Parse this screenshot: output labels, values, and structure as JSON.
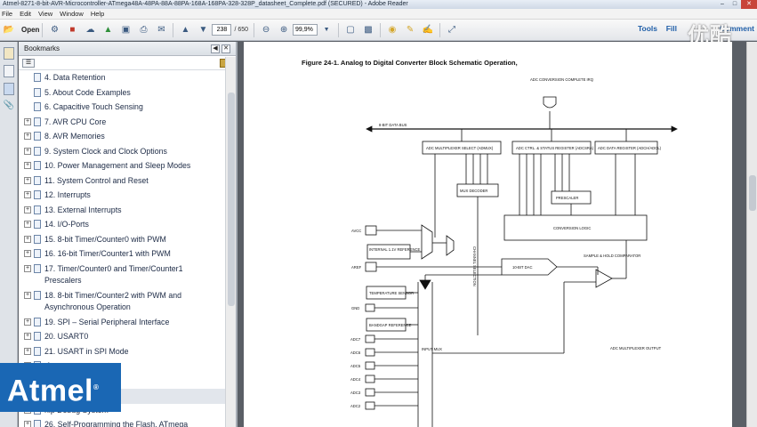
{
  "window": {
    "title": "Atmel-8271-8-bit-AVR-Microcontroller-ATmega48A-48PA-88A-88PA-168A-168PA-328-328P_datasheet_Complete.pdf (SECURED) - Adobe Reader",
    "controls": [
      "–",
      "□",
      "✕"
    ]
  },
  "menu": [
    "File",
    "Edit",
    "View",
    "Window",
    "Help"
  ],
  "toolbar": {
    "open_label": "Open",
    "page_current": "238",
    "page_total": "/ 650",
    "zoom": "99,9%",
    "tools_label": "Tools",
    "fill_label": "Fill",
    "comment_label": "Comment"
  },
  "watermark": "优酷",
  "bookmarks": {
    "title": "Bookmarks",
    "items": [
      {
        "label": "4. Data Retention",
        "expandable": false
      },
      {
        "label": "5. About Code Examples",
        "expandable": false
      },
      {
        "label": "6. Capacitive Touch Sensing",
        "expandable": false
      },
      {
        "label": "7. AVR CPU Core",
        "expandable": true
      },
      {
        "label": "8. AVR Memories",
        "expandable": true
      },
      {
        "label": "9. System Clock and Clock Options",
        "expandable": true
      },
      {
        "label": "10. Power Management and Sleep Modes",
        "expandable": true
      },
      {
        "label": "11. System Control and Reset",
        "expandable": true
      },
      {
        "label": "12. Interrupts",
        "expandable": true
      },
      {
        "label": "13. External Interrupts",
        "expandable": true
      },
      {
        "label": "14. I/O-Ports",
        "expandable": true
      },
      {
        "label": "15. 8-bit Timer/Counter0 with PWM",
        "expandable": true
      },
      {
        "label": "16. 16-bit Timer/Counter1 with PWM",
        "expandable": true
      },
      {
        "label": "17. Timer/Counter0 and Timer/Counter1",
        "label2": "Prescalers",
        "expandable": true
      },
      {
        "label": "18. 8-bit Timer/Counter2 with PWM and",
        "label2": "Asynchronous Operation",
        "expandable": true
      },
      {
        "label": "19. SPI – Serial Peripheral Interface",
        "expandable": true
      },
      {
        "label": "20. USART0",
        "expandable": true
      },
      {
        "label": "21. USART in SPI Mode",
        "expandable": true
      },
      {
        "label": "rface",
        "expandable": true
      },
      {
        "label": "tor",
        "expandable": true
      },
      {
        "label": "l Converter",
        "expandable": true,
        "selected": true
      },
      {
        "label": "hip Debug System",
        "expandable": true
      },
      {
        "label": "26. Self-Programming the Flash, ATmega",
        "expandable": true
      }
    ]
  },
  "figure": {
    "title": "Figure 24-1.     Analog to Digital Converter Block Schematic Operation,",
    "labels": {
      "irq": "ADC CONVERSION COMPLETE IRQ",
      "databus": "8-BIT DATA BUS",
      "admux": "ADC MULTIPLEXER SELECT (ADMUX)",
      "adcsra": "ADC CTRL. & STATUS REGISTER (ADCSRA)",
      "adc_reg": "ADC DATA REGISTER (ADCH/ADCL)",
      "mux_decoder": "MUX DECODER",
      "prescaler": "PRESCALER",
      "conversion_logic": "CONVERSION LOGIC",
      "avcc": "AVCC",
      "aref": "AREF",
      "gnd": "GND",
      "internal_ref": "INTERNAL 1.1V REFERENCE",
      "dac": "10-BIT DAC",
      "sample_hold": "SAMPLE & HOLD COMPARATOR",
      "temp": "TEMPERATURE SENSOR",
      "bandgap": "BANDGAP REFERENCE",
      "input_mux": "INPUT MUX",
      "adc_mux_out": "ADC MULTIPLEXER OUTPUT",
      "channel_sel": "CHANNEL SELECTION",
      "adc_inputs": [
        "ADC7",
        "ADC6",
        "ADC5",
        "ADC4",
        "ADC3",
        "ADC2"
      ]
    }
  },
  "logo": {
    "text": "Atmel",
    "mark": "®"
  }
}
